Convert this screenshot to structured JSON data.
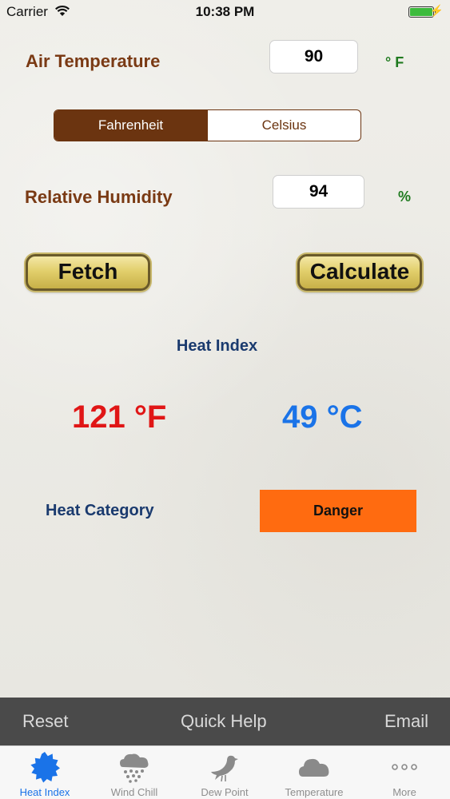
{
  "status_bar": {
    "carrier": "Carrier",
    "time": "10:38 PM"
  },
  "air_temperature": {
    "label": "Air Temperature",
    "value": "90",
    "unit": "° F"
  },
  "unit_toggle": {
    "options": [
      "Fahrenheit",
      "Celsius"
    ],
    "selected": "Fahrenheit"
  },
  "relative_humidity": {
    "label": "Relative Humidity",
    "value": "94",
    "unit": "%"
  },
  "buttons": {
    "fetch": "Fetch",
    "calculate": "Calculate"
  },
  "heat_index": {
    "title": "Heat Index",
    "fahrenheit": "121 °F",
    "celsius": "49 °C"
  },
  "heat_category": {
    "label": "Heat Category",
    "value": "Danger"
  },
  "toolbar": {
    "reset": "Reset",
    "quick_help": "Quick Help",
    "email": "Email"
  },
  "tabs": [
    {
      "label": "Heat Index",
      "icon": "sun-icon",
      "active": true
    },
    {
      "label": "Wind Chill",
      "icon": "snow-cloud-icon",
      "active": false
    },
    {
      "label": "Dew Point",
      "icon": "bird-icon",
      "active": false
    },
    {
      "label": "Temperature",
      "icon": "cloud-icon",
      "active": false
    },
    {
      "label": "More",
      "icon": "more-icon",
      "active": false
    }
  ],
  "colors": {
    "brown": "#7a3a14",
    "segment_brown": "#6b3410",
    "green_unit": "#1f7a1f",
    "navy": "#1a3a6e",
    "red_value": "#e01616",
    "blue_value": "#1a73e8",
    "danger_orange": "#ff6b10",
    "toolbar_bg": "#4a4a4a"
  }
}
